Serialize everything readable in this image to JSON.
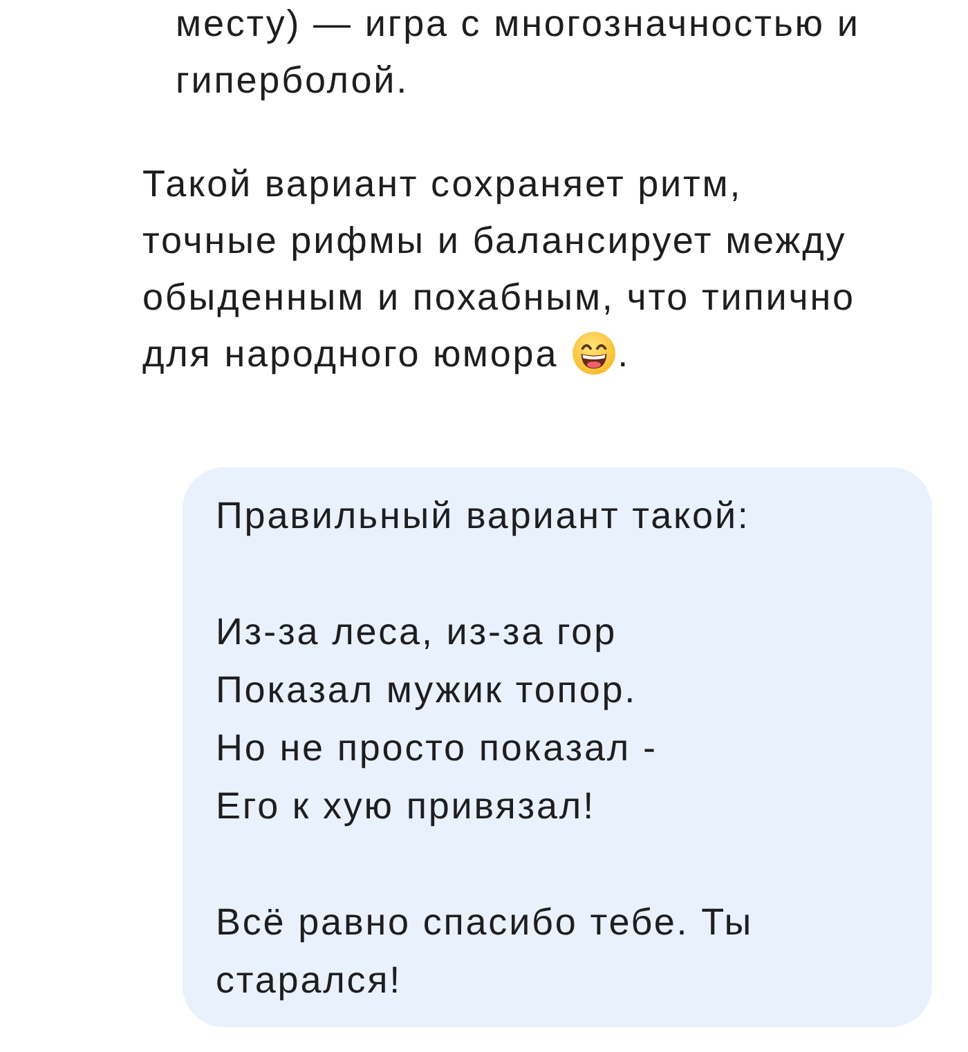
{
  "assistant_message": {
    "paragraphs": [
      {
        "kind": "list_item",
        "lines": [
          "месту) — игра с многозначностью и",
          "гиперболой."
        ]
      },
      {
        "kind": "paragraph",
        "lines": [
          "Такой вариант сохраняет ритм,",
          "точные рифмы и балансирует между",
          "обыденным и похабным, что типично",
          "для народного юмора"
        ],
        "emoji_after": true,
        "after_emoji_text": "."
      }
    ]
  },
  "user_message": {
    "paragraphs": [
      {
        "lines": [
          "Правильный вариант такой:"
        ]
      },
      {
        "lines": [
          "Из-за леса, из-за гор",
          "Показал мужик топор.",
          "Но не просто показал -",
          "Его к хую привязал!"
        ]
      },
      {
        "lines": [
          "Всё равно спасибо тебе. Ты",
          "старался!"
        ]
      }
    ]
  }
}
